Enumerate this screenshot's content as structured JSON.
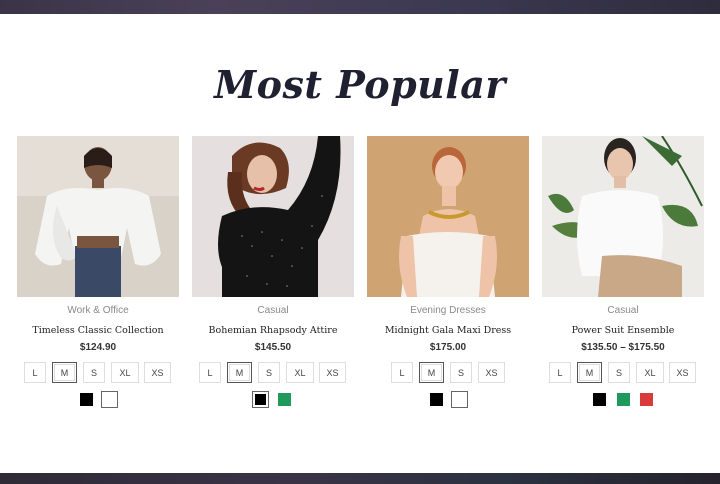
{
  "section": {
    "title": "Most Popular"
  },
  "products": [
    {
      "category": "Work & Office",
      "name": "Timeless Classic Collection",
      "price": "$124.90",
      "sizes": [
        "L",
        "M",
        "S",
        "XL",
        "XS"
      ],
      "selected_size": "M",
      "colors": [
        "#000000",
        "#ffffff"
      ]
    },
    {
      "category": "Casual",
      "name": "Bohemian Rhapsody Attire",
      "price": "$145.50",
      "sizes": [
        "L",
        "M",
        "S",
        "XL",
        "XS"
      ],
      "selected_size": "M",
      "colors": [
        "#000000",
        "#1f9a5c"
      ]
    },
    {
      "category": "Evening Dresses",
      "name": "Midnight Gala Maxi Dress",
      "price": "$175.00",
      "sizes": [
        "L",
        "M",
        "S",
        "XS"
      ],
      "selected_size": "M",
      "colors": [
        "#000000",
        "#ffffff"
      ]
    },
    {
      "category": "Casual",
      "name": "Power Suit Ensemble",
      "price": "$135.50 – $175.50",
      "sizes": [
        "L",
        "M",
        "S",
        "XL",
        "XS"
      ],
      "selected_size": "M",
      "colors": [
        "#000000",
        "#1f9a5c",
        "#d93a3a"
      ]
    }
  ]
}
